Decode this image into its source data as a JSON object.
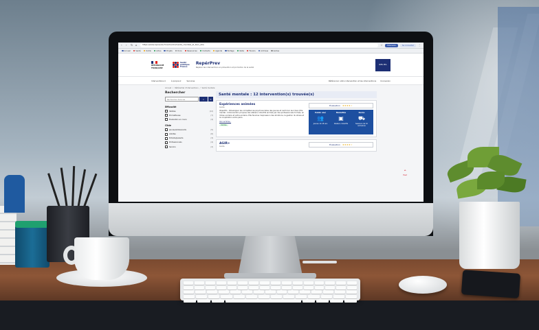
{
  "browser": {
    "url": "https://www.reperprev.fr/recherche?sante_mentale_et_bien_etre",
    "ext_primary": "Extension",
    "ext_secondary": "Se connecter",
    "bookmarks": [
      {
        "label": "Accueil",
        "color": "#3b5bab"
      },
      {
        "label": "Santé",
        "color": "#e2231a"
      },
      {
        "label": "Outils",
        "color": "#f1a200"
      },
      {
        "label": "Actus",
        "color": "#1a9a4a"
      },
      {
        "label": "Projets",
        "color": "#3b5bab"
      },
      {
        "label": "Docs",
        "color": "#888888"
      },
      {
        "label": "Ressources",
        "color": "#e2231a"
      },
      {
        "label": "Contacts",
        "color": "#1a9a4a"
      },
      {
        "label": "Agenda",
        "color": "#f1a200"
      },
      {
        "label": "Partage",
        "color": "#3b5bab"
      },
      {
        "label": "Veille",
        "color": "#1a9a4a"
      },
      {
        "label": "Favoris",
        "color": "#e2231a"
      },
      {
        "label": "Archives",
        "color": "#3b5bab"
      },
      {
        "label": "Autres",
        "color": "#888888"
      }
    ]
  },
  "header": {
    "rf_line1": "RÉPUBLIQUE",
    "rf_line2": "FRANÇAISE",
    "sp_line1": "Santé",
    "sp_line2": "publique",
    "sp_line3": "France",
    "site_title": "RepérPrev",
    "tagline": "Repérer les interventions en prévention et promotion de la santé",
    "partner": "IRES PDL"
  },
  "nav": {
    "items": [
      "Interventions ▾",
      "À propos ▾",
      "Services"
    ],
    "right": [
      "Référencer votre intervention et les interventions",
      "Connexion"
    ]
  },
  "breadcrumb": [
    "Accueil",
    "/",
    "Référentiel d'interventions",
    "/",
    "Santé mentale"
  ],
  "sidebar": {
    "title": "Rechercher",
    "search_placeholder": "Rechercher dans les",
    "search_icon": "search-icon",
    "facets": [
      {
        "title": "Efficacité",
        "rows": [
          {
            "label": "Validée",
            "count": "(12)"
          },
          {
            "label": "Prometteuse",
            "count": "(7)"
          },
          {
            "label": "Évaluation en cours",
            "count": "(4)"
          }
        ]
      },
      {
        "title": "Cible",
        "rows": [
          {
            "label": "Jeunes/adolescents",
            "count": "(5)"
          },
          {
            "label": "Adultes",
            "count": "(6)"
          },
          {
            "label": "Enfants/parents",
            "count": "(3)"
          },
          {
            "label": "Professionnels",
            "count": "(4)"
          },
          {
            "label": "Seniors",
            "count": "(2)"
          }
        ]
      }
    ]
  },
  "content": {
    "heading": "Santé mentale : 12 intervention(s) trouvée(s)",
    "cards": [
      {
        "title": "Expériences animées",
        "subtitle": "Guide",
        "body": "Objectifs : Développer les compétences psychosociales des jeunes et renforcer leur bien-être mental. L'intervention propose des ateliers collectifs animés par des professionnels formés, en milieu scolaire et extra-scolaire. Elle favorise l'expression des émotions, la gestion du stress et la coopération entre pairs.",
        "link": "Voir la fiche ›",
        "tag": "Validée",
        "rating_label": "Évaluation",
        "stars": "★★★★☆",
        "panel": [
          {
            "head": "Public visé",
            "icon": "people-icon",
            "glyph": "👥",
            "text": "Jeunes 12-18 ans"
          },
          {
            "head": "Modalités",
            "icon": "box-icon",
            "glyph": "▣",
            "text": "Ateliers collectifs"
          },
          {
            "head": "Durée",
            "icon": "car-icon",
            "glyph": "⛟",
            "text": "Sessions de 10 semaines"
          }
        ]
      },
      {
        "title": "AGIR+",
        "subtitle": "Guide",
        "rating_label": "Évaluation",
        "stars": "★★★★☆"
      }
    ]
  },
  "scroll_top": {
    "arrow": "⌃",
    "label": "Haut"
  }
}
